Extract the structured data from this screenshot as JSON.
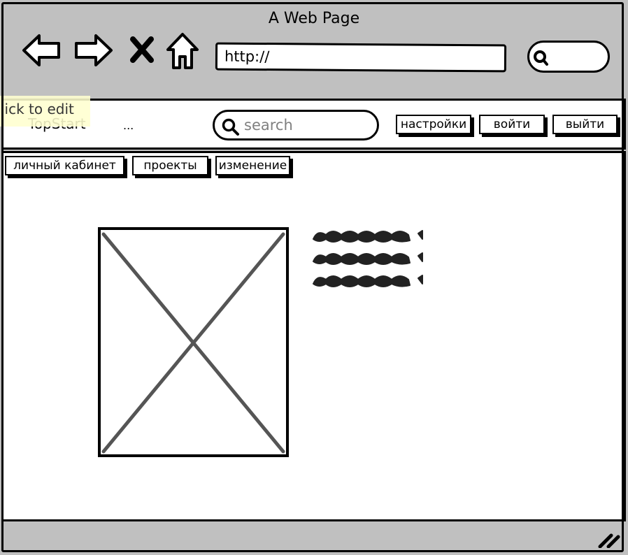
{
  "window": {
    "title": "A Web Page"
  },
  "browser": {
    "url": "http://"
  },
  "header": {
    "logo": "TopStart",
    "ellipsis": "...",
    "search_placeholder": "search",
    "buttons": [
      "настройки",
      "войти",
      "выйти"
    ]
  },
  "tooltip": {
    "text": "Click to edit"
  },
  "tabs": [
    "личный кабинет",
    "проекты",
    "изменение"
  ],
  "icons": {
    "back": "back-arrow-icon",
    "forward": "forward-arrow-icon",
    "stop": "close-icon",
    "home": "home-icon",
    "search": "search-icon",
    "resize": "resize-grip-icon",
    "image": "image-placeholder-icon"
  },
  "colors": {
    "chrome": "#c0c0c0",
    "ink": "#000000",
    "placeholder_text": "#808080",
    "tooltip_bg": "#ffffd0"
  }
}
